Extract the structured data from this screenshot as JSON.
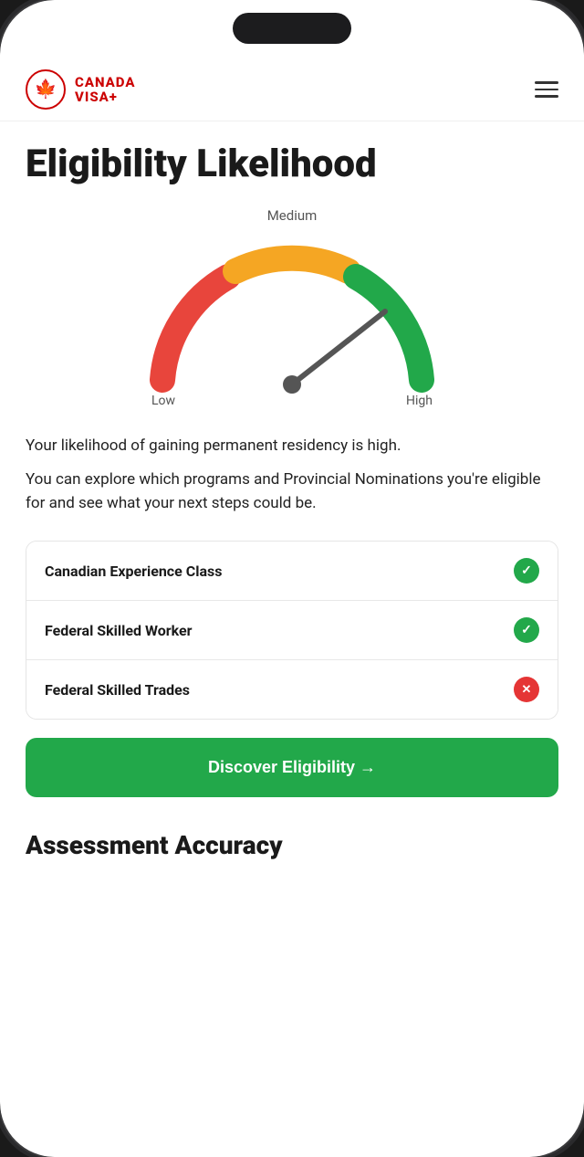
{
  "header": {
    "logo_canada": "CANADA",
    "logo_visa": "VISA+",
    "menu_icon_label": "menu"
  },
  "page": {
    "title": "Eligibility Likelihood"
  },
  "gauge": {
    "label_medium": "Medium",
    "label_low": "Low",
    "label_high": "High",
    "needle_angle": 65,
    "colors": {
      "low": "#e8453c",
      "medium": "#f5a623",
      "high": "#22a84a",
      "needle": "#555555"
    }
  },
  "description": {
    "line1": "Your likelihood of gaining permanent residency is high.",
    "line2": "You can explore which programs and Provincial Nominations you're eligible for and see what your next steps could be."
  },
  "programs": [
    {
      "name": "Canadian Experience Class",
      "status": "check"
    },
    {
      "name": "Federal Skilled Worker",
      "status": "check"
    },
    {
      "name": "Federal Skilled Trades",
      "status": "cross"
    }
  ],
  "cta": {
    "label": "Discover Eligibility →"
  },
  "assessment": {
    "title": "Assessment Accuracy"
  }
}
